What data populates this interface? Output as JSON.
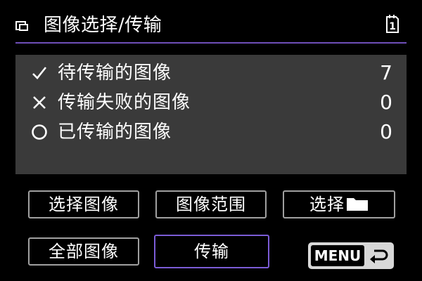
{
  "header": {
    "title": "图像选择/传输",
    "title_icon": "transfer-image-icon",
    "slot_icon": "card-slot-1-icon",
    "slot_number": "1"
  },
  "status": [
    {
      "icon": "check-icon",
      "label": "待传输的图像",
      "count": "7"
    },
    {
      "icon": "cross-icon",
      "label": "传输失败的图像",
      "count": "0"
    },
    {
      "icon": "circle-icon",
      "label": "已传输的图像",
      "count": "0"
    }
  ],
  "buttons": {
    "select_images": "选择图像",
    "image_range": "图像范围",
    "select_folder": "选择",
    "all_images": "全部图像",
    "transfer": "传输",
    "menu": "MENU"
  },
  "colors": {
    "background": "#000000",
    "panel": "#3a3a3a",
    "accent": "#7b5cd6",
    "button_border": "#a0a0a0"
  }
}
